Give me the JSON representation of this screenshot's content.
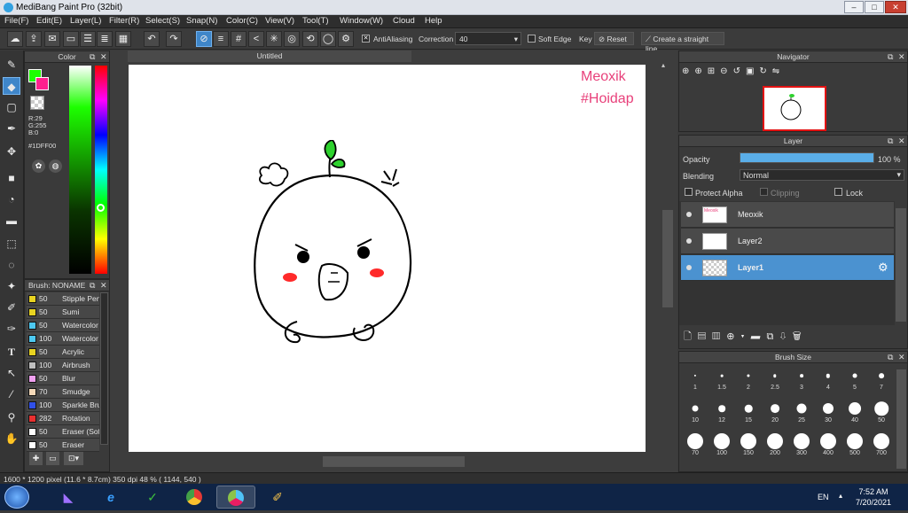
{
  "window": {
    "title": "MediBang Paint Pro (32bit)"
  },
  "menu": [
    "File(F)",
    "Edit(E)",
    "Layer(L)",
    "Filter(R)",
    "Select(S)",
    "Snap(N)",
    "Color(C)",
    "View(V)",
    "Tool(T)",
    "Window(W)",
    "Cloud",
    "Help"
  ],
  "toolbar": {
    "antialiasing_label": "AntiAliasing",
    "correction_label": "Correction",
    "correction_value": "40",
    "soft_edge_label": "Soft Edge",
    "key_label": "Key",
    "reset_label": "Reset",
    "straight_line_label": "Create a straight line"
  },
  "color_panel": {
    "title": "Color",
    "r": "R:29",
    "g": "G:255",
    "b": "B:0",
    "hex": "#1DFF00",
    "main_color": "#1dff00",
    "sub_color": "#ff1f8e"
  },
  "brush_panel": {
    "title": "Brush: NONAME",
    "items": [
      {
        "size": "50",
        "name": "Stipple Pen",
        "color": "#e8d321"
      },
      {
        "size": "50",
        "name": "Sumi",
        "color": "#e8d321"
      },
      {
        "size": "50",
        "name": "Watercolor",
        "color": "#4dc8f0"
      },
      {
        "size": "100",
        "name": "Watercolor",
        "color": "#4dc8f0"
      },
      {
        "size": "50",
        "name": "Acrylic",
        "color": "#e8d321"
      },
      {
        "size": "100",
        "name": "Airbrush",
        "color": "#bfbfbf"
      },
      {
        "size": "50",
        "name": "Blur",
        "color": "#f0a0f0"
      },
      {
        "size": "70",
        "name": "Smudge",
        "color": "#f3d8b8"
      },
      {
        "size": "100",
        "name": "Sparkle Brush",
        "color": "#3050e8"
      },
      {
        "size": "282",
        "name": "Rotation",
        "color": "#e83030"
      },
      {
        "size": "50",
        "name": "Eraser (Soft)",
        "color": "#ffffff"
      },
      {
        "size": "50",
        "name": "Eraser",
        "color": "#ffffff"
      }
    ]
  },
  "canvas": {
    "tab": "Untitled",
    "watermark_line1": "Meoxik",
    "watermark_line2": "#Hoidap"
  },
  "navigator": {
    "title": "Navigator"
  },
  "layer_panel": {
    "title": "Layer",
    "opacity_label": "Opacity",
    "opacity_value": "100 %",
    "opacity_fraction": 1.0,
    "blending_label": "Blending",
    "blending_value": "Normal",
    "protect_alpha_label": "Protect Alpha",
    "clipping_label": "Clipping",
    "lock_label": "Lock",
    "layers": [
      {
        "name": "Meoxik",
        "active": false
      },
      {
        "name": "Layer2",
        "active": false
      },
      {
        "name": "Layer1",
        "active": true
      }
    ]
  },
  "brush_size": {
    "title": "Brush Size",
    "sizes": [
      "1",
      "1.5",
      "2",
      "2.5",
      "3",
      "4",
      "5",
      "7",
      "10",
      "12",
      "15",
      "20",
      "25",
      "30",
      "40",
      "50",
      "70",
      "100",
      "150",
      "200",
      "300",
      "400",
      "500",
      "700",
      "1000"
    ]
  },
  "status": {
    "text": "1600 * 1200 pixel   (11.6 * 8.7cm)   350 dpi   48 %   ( 1144, 540 )"
  },
  "taskbar": {
    "lang": "EN",
    "time": "7:52 AM",
    "date": "7/20/2021"
  },
  "colors": {
    "accent": "#4b92d0",
    "text_pink": "#e8407a"
  }
}
